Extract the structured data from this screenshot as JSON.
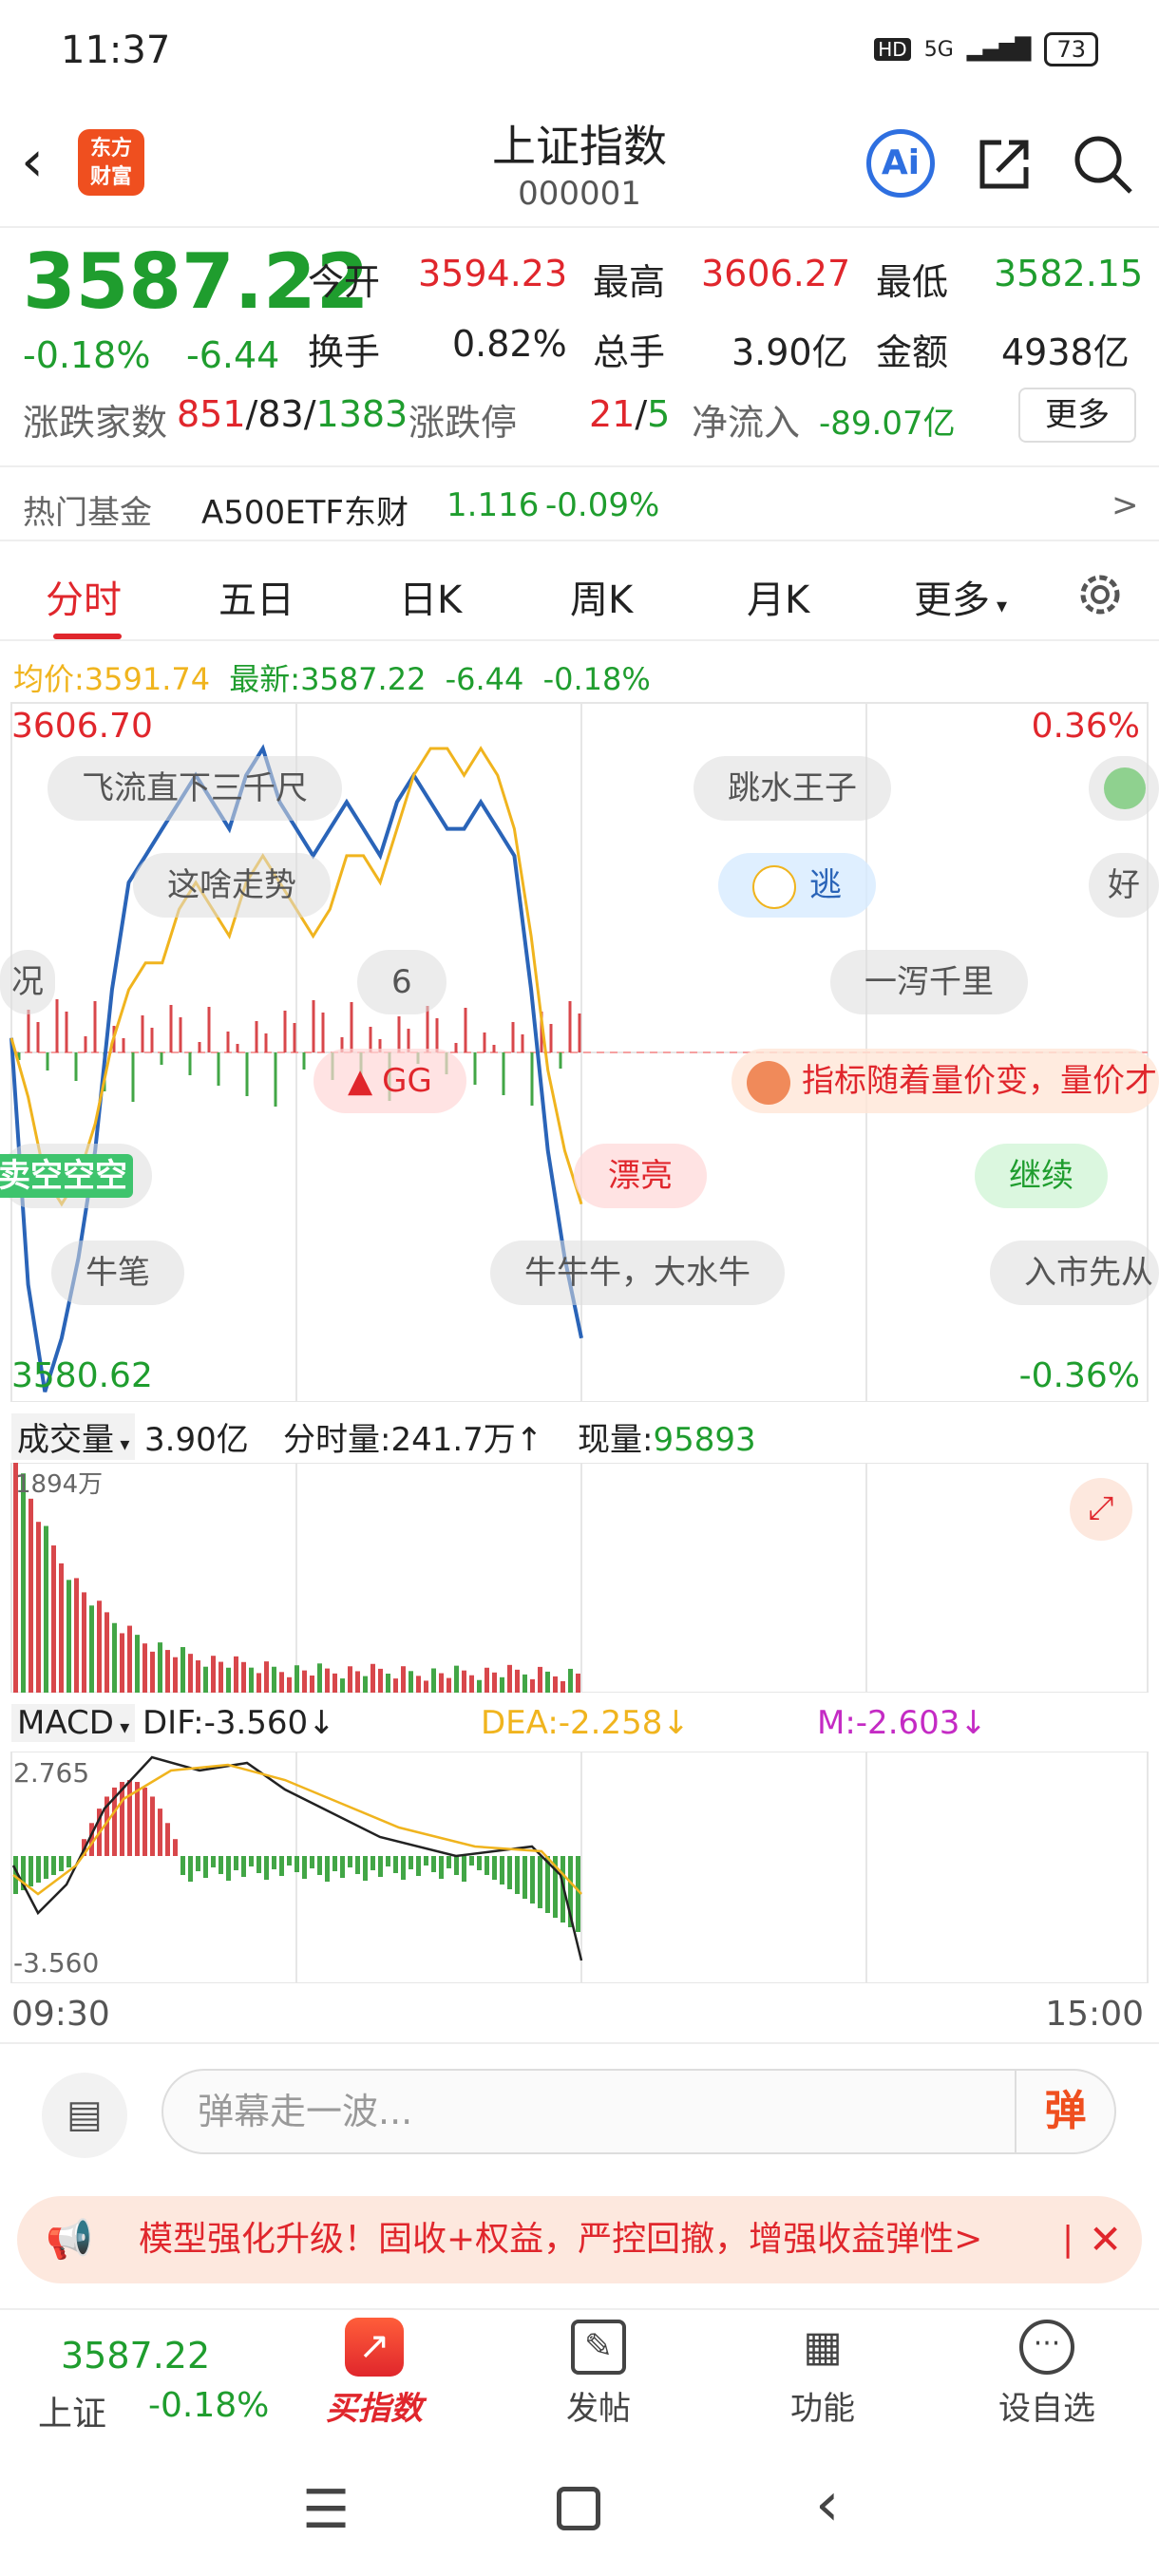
{
  "status": {
    "time": "11:37",
    "network": "5G",
    "hd": "HD",
    "battery": "73"
  },
  "header": {
    "logo_line1": "东方",
    "logo_line2": "财富",
    "title": "上证指数",
    "code": "000001",
    "ai_label": "Ai"
  },
  "quote": {
    "price": "3587.22",
    "change_pct": "-0.18%",
    "change": "-6.44",
    "open_label": "今开",
    "open": "3594.23",
    "high_label": "最高",
    "high": "3606.27",
    "low_label": "最低",
    "low": "3582.15",
    "turnover_label": "换手",
    "turnover": "0.82%",
    "volume_label": "总手",
    "volume": "3.90亿",
    "amount_label": "金额",
    "amount": "4938亿",
    "breadth_label": "涨跌家数",
    "up": "851",
    "flat": "83",
    "down": "1383",
    "limit_label": "涨跌停",
    "limit_up": "21",
    "limit_down": "5",
    "inflow_label": "净流入",
    "inflow": "-89.07亿",
    "more_button": "更多"
  },
  "fund": {
    "label": "热门基金",
    "name": "A500ETF东财",
    "price": "1.116",
    "change": "-0.09%",
    "arrow": ">"
  },
  "tabs": [
    "分时",
    "五日",
    "日K",
    "周K",
    "月K",
    "更多"
  ],
  "avgline": {
    "avg_label": "均价:",
    "avg": "3591.74",
    "last_label": "最新:",
    "last": "3587.22",
    "chg": "-6.44",
    "pct": "-0.18%"
  },
  "chart_axis": {
    "top_price": "3606.70",
    "top_pct": "0.36%",
    "bottom_price": "3580.62",
    "bottom_pct": "-0.36%",
    "start_time": "09:30",
    "end_time": "15:00"
  },
  "danmaku": [
    "飞流直下三千尺",
    "跳水王子",
    "这啥走势",
    "逃",
    "好",
    "况",
    "6",
    "一泻千里",
    "GG",
    "指标随着量价变，量价才",
    "卖空空空",
    "漂亮",
    "继续",
    "牛笔",
    "牛牛牛，大水牛",
    "入市先从"
  ],
  "volume_header": {
    "label": "成交量",
    "total": "3.90亿",
    "tick_label": "分时量:",
    "tick": "241.7万",
    "now_label": "现量:",
    "now": "95893",
    "max": "1894万"
  },
  "macd_header": {
    "label": "MACD",
    "dif": "DIF:-3.560",
    "dea": "DEA:-2.258",
    "m": "M:-2.603",
    "top": "2.765",
    "bottom": "-3.560"
  },
  "comment": {
    "placeholder": "弹幕走一波...",
    "send_label": "弹"
  },
  "promo": {
    "text": "模型强化升级！固收+权益，严控回撤，增强收益弹性>"
  },
  "bottombar": {
    "price": "3587.22",
    "name": "上证",
    "pct": "-0.18%",
    "buy": "买指数",
    "post": "发帖",
    "func": "功能",
    "watch": "设自选"
  },
  "colors": {
    "up": "#e0262c",
    "down": "#1f9d2e",
    "price_line": "#2a64b8",
    "avg_line": "#f0b41e",
    "brand": "#ef4f1f"
  },
  "chart_data": {
    "type": "line",
    "title": "",
    "x_range": [
      "09:30",
      "15:00"
    ],
    "ylim": [
      3580.62,
      3606.7
    ],
    "series": [
      {
        "name": "最新",
        "values": [
          3594.2,
          3585,
          3581,
          3583,
          3586,
          3590,
          3596,
          3600,
          3601,
          3602,
          3603,
          3604,
          3603,
          3602,
          3604,
          3605,
          3603,
          3602,
          3601,
          3602,
          3603,
          3602,
          3601,
          3603,
          3604,
          3603,
          3602,
          3602,
          3603,
          3602,
          3601,
          3596,
          3590,
          3586,
          3583
        ]
      },
      {
        "name": "均价",
        "values": [
          3594.2,
          3592,
          3589,
          3588,
          3589,
          3591,
          3594,
          3596,
          3597,
          3597,
          3599,
          3600,
          3599,
          3598,
          3600,
          3601,
          3600,
          3599,
          3598,
          3599,
          3601,
          3601,
          3600,
          3602,
          3604,
          3605,
          3605,
          3604,
          3605,
          3604,
          3602,
          3598,
          3593,
          3590,
          3588
        ]
      }
    ]
  }
}
